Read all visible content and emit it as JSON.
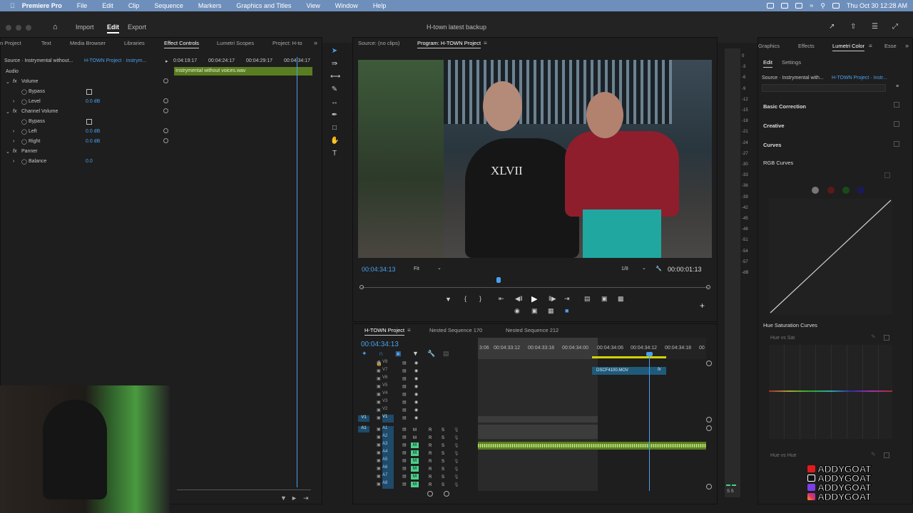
{
  "menubar": {
    "app": "Premiere Pro",
    "items": [
      "File",
      "Edit",
      "Clip",
      "Sequence",
      "Markers",
      "Graphics and Titles",
      "View",
      "Window",
      "Help"
    ],
    "clock": "Thu Oct 30  12:28 AM"
  },
  "window": {
    "title": "H-town latest backup",
    "nav": {
      "import": "Import",
      "edit": "Edit",
      "export": "Export"
    }
  },
  "left_tabs": [
    "n Project",
    "Text",
    "Media Browser",
    "Libraries",
    "Effect Controls",
    "Lumetri Scopes",
    "Project: H-to"
  ],
  "effect_controls": {
    "source": "Source · Instrymental without...",
    "sequence": "H-TOWN Project · Instrym...",
    "timecodes": [
      "0:04:19:17",
      "00:04:24:17",
      "00:04:29:17",
      "00:04:34:17"
    ],
    "clip": "Instrymental without voices.wav",
    "section": "Audio",
    "rows": [
      {
        "name": "Volume",
        "value": ""
      },
      {
        "name": "Bypass",
        "value": ""
      },
      {
        "name": "Level",
        "value": "0.0 dB"
      },
      {
        "name": "Channel Volume",
        "value": ""
      },
      {
        "name": "Bypass",
        "value": ""
      },
      {
        "name": "Left",
        "value": "0.0 dB"
      },
      {
        "name": "Right",
        "value": "0.0 dB"
      },
      {
        "name": "Panner",
        "value": ""
      },
      {
        "name": "Balance",
        "value": "0.0"
      }
    ]
  },
  "monitor": {
    "source_tab": "Source: (no clips)",
    "program_tab": "Program: H-TOWN Project",
    "timecode": "00:04:34:13",
    "fit": "Fit",
    "res": "1/8",
    "duration": "00:00:01:13",
    "shirt_text": "XLVII"
  },
  "timeline": {
    "tabs": [
      "H-TOWN Project",
      "Nested Sequence 170",
      "Nested Sequence 212"
    ],
    "timecode": "00:04:34:13",
    "ruler": [
      "3:06",
      "00:04:33:12",
      "00:04:33:18",
      "00:04:34:00",
      "00:04:34:06",
      "00:04:34:12",
      "00:04:34:18",
      "00"
    ],
    "video_tracks": [
      "V8",
      "V7",
      "V6",
      "V5",
      "V4",
      "V3",
      "V2",
      "V1"
    ],
    "audio_tracks": [
      "A1",
      "A2",
      "A3",
      "A4",
      "A5",
      "A6",
      "A7",
      "A8"
    ],
    "clip": "DSCF4100.MOV",
    "mute": "M",
    "rec": "R",
    "solo": "S"
  },
  "meter": {
    "ticks": [
      "0",
      "-3",
      "-6",
      "-9",
      "-12",
      "-15",
      "-18",
      "-21",
      "-24",
      "-27",
      "-30",
      "-33",
      "-36",
      "-39",
      "-42",
      "-45",
      "-48",
      "-51",
      "-54",
      "-57",
      "-dB"
    ],
    "ls": "S S"
  },
  "lumetri": {
    "tabs": [
      "Graphics",
      "Effects",
      "Lumetri Color",
      "Esse"
    ],
    "subtabs": [
      "Edit",
      "Settings"
    ],
    "source": "Source · Instrymental with...",
    "sequence": "H-TOWN Project · Instr...",
    "sections": [
      "Basic Correction",
      "Creative",
      "Curves",
      "RGB Curves",
      "Hue Saturation Curves"
    ],
    "hue_vs_sat": "Hue vs Sat",
    "hue_vs_hue": "Hue vs Hue"
  },
  "branding": [
    "ADDYGOAT",
    "ADDYGOAT",
    "ADDYGOAT",
    "ADDYGOAT"
  ],
  "colors": {
    "accent": "#4aa0f0",
    "audio": "#4bcf8a",
    "clip_green": "#5a7d21",
    "mac_bar": "#6e8fbb"
  }
}
